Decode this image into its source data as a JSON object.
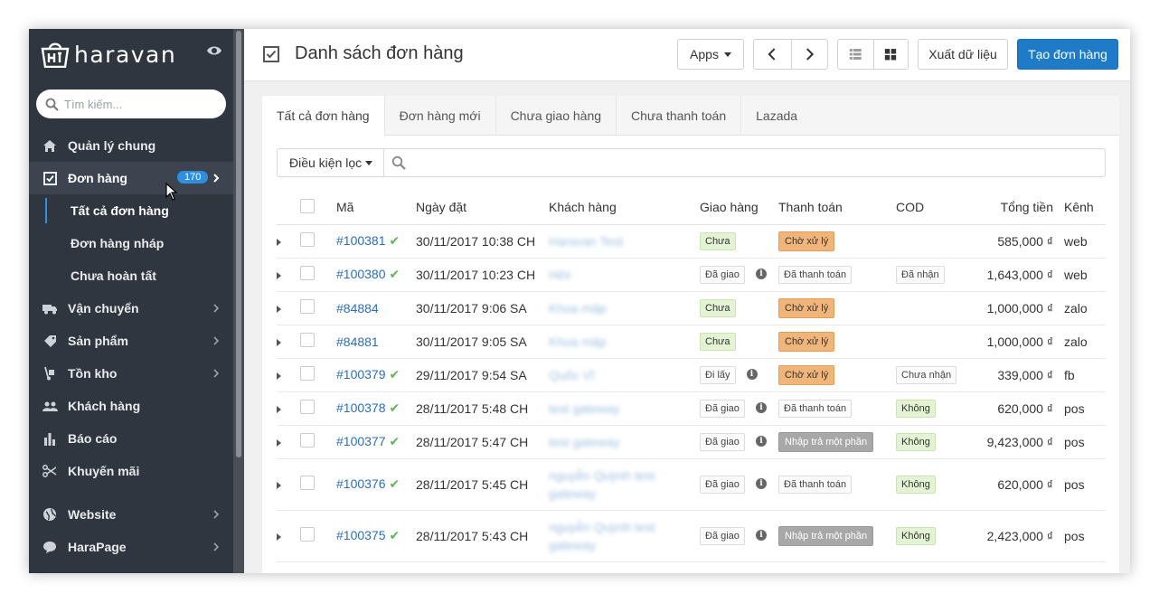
{
  "brand": {
    "name": "haravan"
  },
  "search": {
    "placeholder": "Tìm kiếm..."
  },
  "sidebar": {
    "items": [
      {
        "label": "Quản lý chung",
        "icon": "home-icon"
      },
      {
        "label": "Đơn hàng",
        "icon": "checkbox-icon",
        "badge": "170"
      },
      {
        "label": "Vận chuyển",
        "icon": "truck-icon"
      },
      {
        "label": "Sản phẩm",
        "icon": "tag-icon"
      },
      {
        "label": "Tồn kho",
        "icon": "dolly-icon"
      },
      {
        "label": "Khách hàng",
        "icon": "users-icon"
      },
      {
        "label": "Báo cáo",
        "icon": "bar-chart-icon"
      },
      {
        "label": "Khuyến mãi",
        "icon": "scissors-icon"
      },
      {
        "label": "Website",
        "icon": "globe-icon"
      },
      {
        "label": "HaraPage",
        "icon": "chat-bubble-icon"
      }
    ],
    "sub_items": [
      {
        "label": "Tất cả đơn hàng"
      },
      {
        "label": "Đơn hàng nháp"
      },
      {
        "label": "Chưa hoàn tất"
      }
    ]
  },
  "header": {
    "title": "Danh sách đơn hàng",
    "apps_label": "Apps",
    "export_label": "Xuất dữ liệu",
    "create_label": "Tạo đơn hàng"
  },
  "tabs": [
    {
      "label": "Tất cả đơn hàng"
    },
    {
      "label": "Đơn hàng mới"
    },
    {
      "label": "Chưa giao hàng"
    },
    {
      "label": "Chưa thanh toán"
    },
    {
      "label": "Lazada"
    }
  ],
  "filter": {
    "label": "Điều kiện lọc"
  },
  "table": {
    "headers": {
      "code": "Mã",
      "date": "Ngày đặt",
      "customer": "Khách hàng",
      "shipping": "Giao hàng",
      "payment": "Thanh toán",
      "cod": "COD",
      "total": "Tổng tiền",
      "channel": "Kênh"
    },
    "rows": [
      {
        "code": "#100381",
        "check": "✔",
        "date": "30/11/2017 10:38 CH",
        "customer": "Haravan Test",
        "shipping": "Chưa",
        "payment": "Chờ xử lý",
        "cod": "",
        "total": "585,000 ₫",
        "channel": "web"
      },
      {
        "code": "#100380",
        "check": "✔",
        "date": "30/11/2017 10:23 CH",
        "customer": "Hihi",
        "shipping": "Đã giao",
        "payment": "Đã thanh toán",
        "cod": "Đã nhận",
        "total": "1,643,000 ₫",
        "channel": "web"
      },
      {
        "code": "#84884",
        "check": "",
        "date": "30/11/2017 9:06 SA",
        "customer": "Khoa mập",
        "shipping": "Chưa",
        "payment": "Chờ xử lý",
        "cod": "",
        "total": "1,000,000 ₫",
        "channel": "zalo"
      },
      {
        "code": "#84881",
        "check": "",
        "date": "30/11/2017 9:05 SA",
        "customer": "Khoa mập",
        "shipping": "Chưa",
        "payment": "Chờ xử lý",
        "cod": "",
        "total": "1,000,000 ₫",
        "channel": "zalo"
      },
      {
        "code": "#100379",
        "check": "✔",
        "date": "29/11/2017 9:54 SA",
        "customer": "Quốc Vĩ",
        "shipping": "Đi lấy",
        "payment": "Chờ xử lý",
        "cod": "Chưa nhận",
        "total": "339,000 ₫",
        "channel": "fb"
      },
      {
        "code": "#100378",
        "check": "✔",
        "date": "28/11/2017 5:48 CH",
        "customer": "test gateway",
        "shipping": "Đã giao",
        "payment": "Đã thanh toán",
        "cod": "Không",
        "total": "620,000 ₫",
        "channel": "pos"
      },
      {
        "code": "#100377",
        "check": "✔",
        "date": "28/11/2017 5:47 CH",
        "customer": "test gateway",
        "shipping": "Đã giao",
        "payment": "Nhập trả một phần",
        "cod": "Không",
        "total": "9,423,000 ₫",
        "channel": "pos"
      },
      {
        "code": "#100376",
        "check": "✔",
        "date": "28/11/2017 5:45 CH",
        "customer": "nguyễn Quỳnh test gateway",
        "shipping": "Đã giao",
        "payment": "Đã thanh toán",
        "cod": "Không",
        "total": "620,000 ₫",
        "channel": "pos"
      },
      {
        "code": "#100375",
        "check": "✔",
        "date": "28/11/2017 5:43 CH",
        "customer": "nguyễn Quỳnh test gateway",
        "shipping": "Đã giao",
        "payment": "Nhập trả một phần",
        "cod": "Không",
        "total": "2,423,000 ₫",
        "channel": "pos"
      }
    ]
  },
  "colors": {
    "sidebar_bg": "#2f3640",
    "primary": "#1f7bc7",
    "badge": "#2e8fe0",
    "link": "#2a6ebb",
    "check": "#5cb85c",
    "pending": "#f0b57a"
  }
}
